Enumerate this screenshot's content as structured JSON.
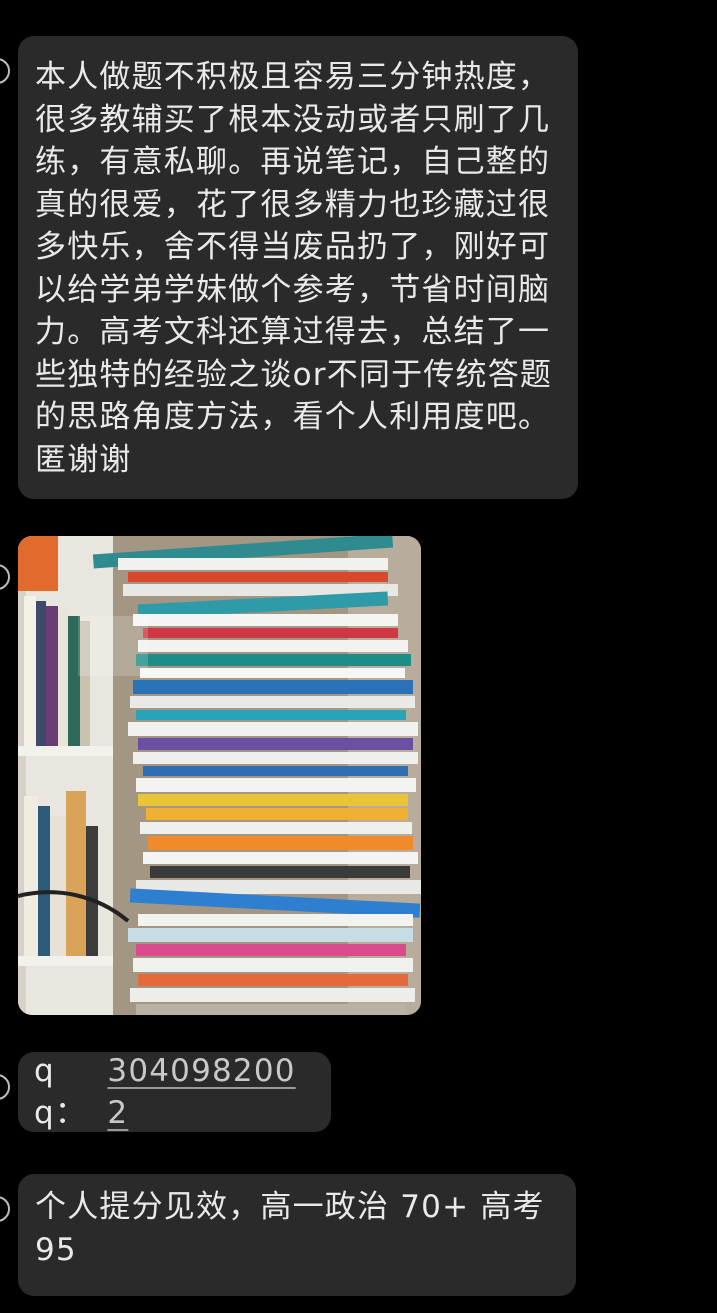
{
  "messages": [
    {
      "type": "text",
      "text": "本人做题不积极且容易三分钟热度，很多教辅买了根本没动或者只刷了几练，有意私聊。再说笔记，自己整的真的很爱，花了很多精力也珍藏过很多快乐，舍不得当废品扔了，刚好可以给学弟学妹做个参考，节省时间脑力。高考文科还算过得去，总结了一些独特的经验之谈or不同于传统答题的思路角度方法，看个人利用度吧。匿谢谢"
    },
    {
      "type": "image",
      "subject": "stack-of-textbooks-and-workbooks"
    },
    {
      "type": "contact",
      "label": "qq：",
      "value": "3040982002"
    },
    {
      "type": "text",
      "text": "个人提分见效，高一政治 70+ 高考95"
    }
  ],
  "colors": {
    "background": "#000000",
    "bubble": "#2a2a2b",
    "text": "#e9e9e9",
    "link": "#c8c8c8"
  }
}
